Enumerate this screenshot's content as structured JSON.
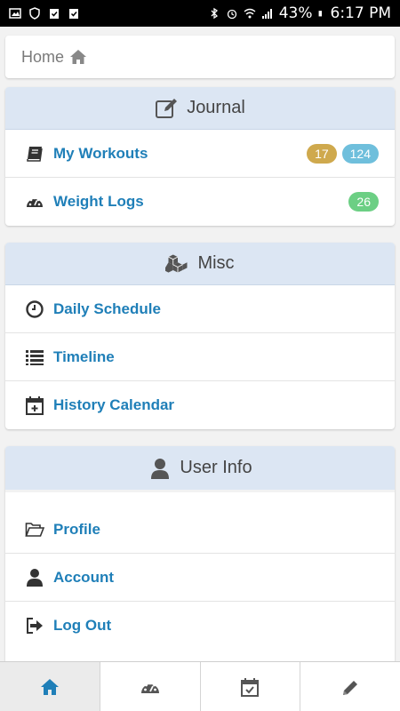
{
  "status_bar": {
    "battery": "43%",
    "time": "6:17 PM"
  },
  "breadcrumb": {
    "home_label": "Home"
  },
  "journal": {
    "title": "Journal",
    "items": [
      {
        "label": "My Workouts",
        "icon": "book-icon",
        "badges": [
          "17",
          "124"
        ]
      },
      {
        "label": "Weight Logs",
        "icon": "speedometer-icon",
        "badges": [
          "26"
        ]
      }
    ]
  },
  "misc": {
    "title": "Misc",
    "items": [
      {
        "label": "Daily Schedule",
        "icon": "clock-icon"
      },
      {
        "label": "Timeline",
        "icon": "list-icon"
      },
      {
        "label": "History Calendar",
        "icon": "calendar-plus-icon"
      }
    ]
  },
  "user_info": {
    "title": "User Info",
    "items": [
      {
        "label": "Profile",
        "icon": "folder-open-icon"
      },
      {
        "label": "Account",
        "icon": "user-icon"
      },
      {
        "label": "Log Out",
        "icon": "sign-out-icon"
      }
    ]
  },
  "tabbar": {
    "tabs": [
      {
        "icon": "home-icon",
        "active": true
      },
      {
        "icon": "speedometer-icon",
        "active": false
      },
      {
        "icon": "calendar-check-icon",
        "active": false
      },
      {
        "icon": "pencil-icon",
        "active": false
      }
    ]
  },
  "colors": {
    "link": "#1f7fb8",
    "panel_header": "#dce6f3",
    "badge_gold": "#cfa94d",
    "badge_blue": "#6fbfdc",
    "badge_green": "#6ccf84"
  }
}
